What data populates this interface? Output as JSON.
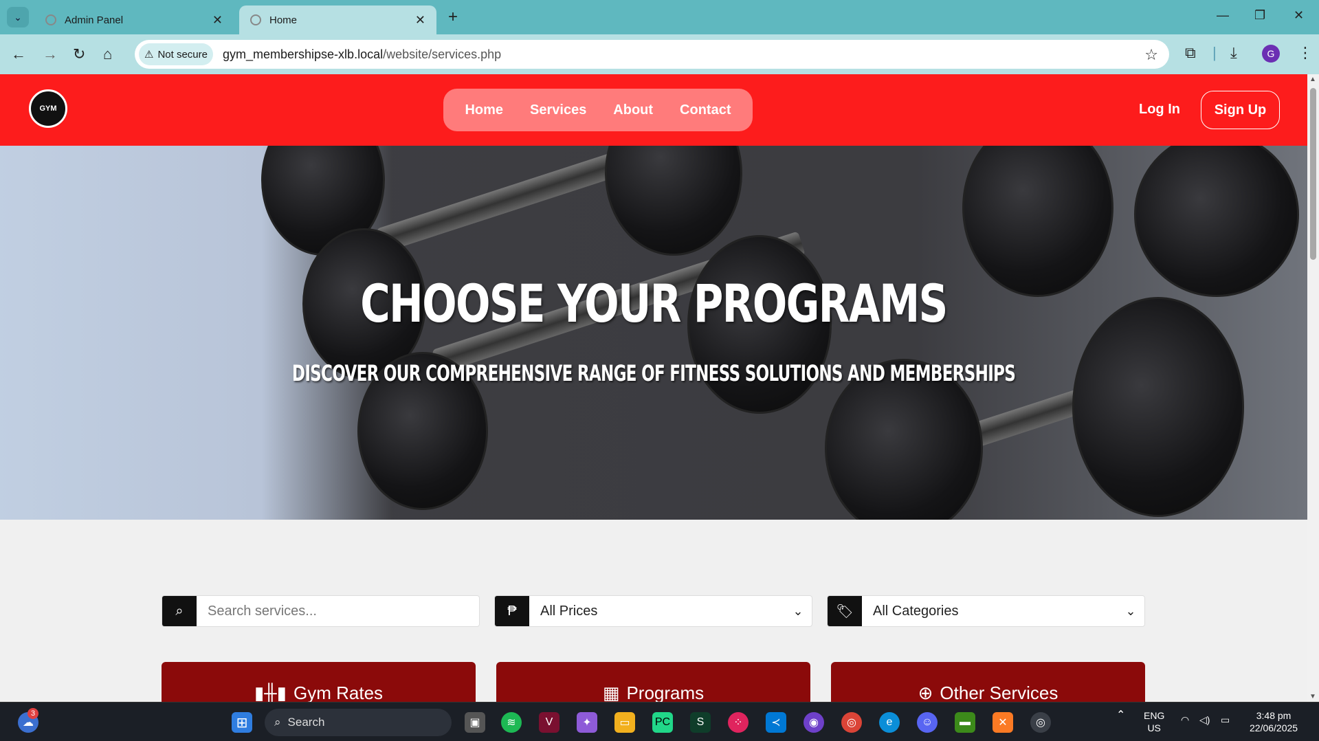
{
  "browser": {
    "tabs": [
      {
        "label": "Admin Panel",
        "active": false
      },
      {
        "label": "Home",
        "active": true
      }
    ],
    "security_label": "Not secure",
    "url_host": "gym_membershipse-xlb.local",
    "url_path": "/website/services.php",
    "profile_initial": "G"
  },
  "nav": {
    "logo_text": "GYM",
    "links": [
      "Home",
      "Services",
      "About",
      "Contact"
    ],
    "login_label": "Log In",
    "signup_label": "Sign Up"
  },
  "hero": {
    "title": "CHOOSE YOUR PROGRAMS",
    "subtitle": "DISCOVER OUR COMPREHENSIVE RANGE OF FITNESS SOLUTIONS AND MEMBERSHIPS"
  },
  "filters": {
    "search_placeholder": "Search services...",
    "price_value": "All Prices",
    "category_value": "All Categories"
  },
  "cards": [
    {
      "label": "Gym Rates",
      "icon": "dumbbell-icon"
    },
    {
      "label": "Programs",
      "icon": "calendar-icon"
    },
    {
      "label": "Other Services",
      "icon": "plus-circle-icon"
    }
  ],
  "taskbar": {
    "search_label": "Search",
    "notification_count": "3",
    "lang_line1": "ENG",
    "lang_line2": "US",
    "time": "3:48 pm",
    "date": "22/06/2025"
  },
  "colors": {
    "nav_red": "#fd1c1c",
    "card_red": "#8b0a0a",
    "tab_teal": "#5fb8bf"
  }
}
